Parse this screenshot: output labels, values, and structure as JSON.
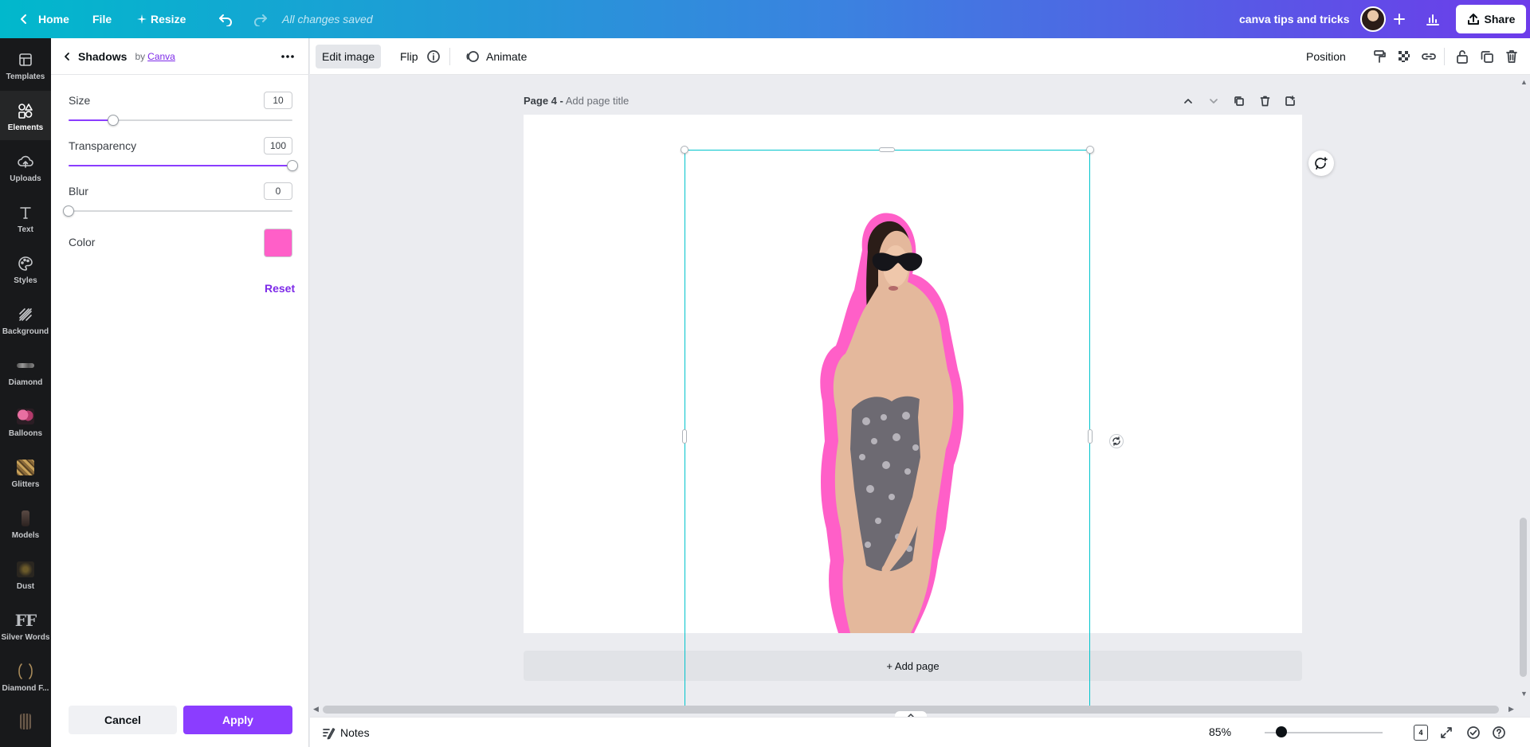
{
  "topbar": {
    "home_label": "Home",
    "file_label": "File",
    "resize_label": "Resize",
    "saved_status": "All changes saved",
    "project_title": "canva tips and tricks",
    "share_label": "Share"
  },
  "rail": {
    "items": [
      {
        "label": "Templates"
      },
      {
        "label": "Elements"
      },
      {
        "label": "Uploads"
      },
      {
        "label": "Text"
      },
      {
        "label": "Styles"
      },
      {
        "label": "Background"
      },
      {
        "label": "Diamond"
      },
      {
        "label": "Balloons"
      },
      {
        "label": "Glitters"
      },
      {
        "label": "Models"
      },
      {
        "label": "Dust"
      },
      {
        "label": "Silver Words"
      },
      {
        "label": "Diamond F..."
      }
    ],
    "silver_glyph": "FF"
  },
  "panel": {
    "title": "Shadows",
    "by_label": "by",
    "by_link": "Canva",
    "size_label": "Size",
    "size_value": "10",
    "size_level": 0.2,
    "transparency_label": "Transparency",
    "transparency_value": "100",
    "transparency_level": 1.0,
    "blur_label": "Blur",
    "blur_value": "0",
    "blur_level": 0.0,
    "color_label": "Color",
    "color_value": "#ff5fc8",
    "reset_label": "Reset",
    "cancel_label": "Cancel",
    "apply_label": "Apply"
  },
  "context_bar": {
    "edit_image_label": "Edit image",
    "flip_label": "Flip",
    "animate_label": "Animate",
    "position_label": "Position"
  },
  "canvas": {
    "page_label": "Page 4 -",
    "page_title_placeholder": "Add page title",
    "add_page_label": "+ Add page"
  },
  "statusbar": {
    "notes_label": "Notes",
    "zoom_label": "85%",
    "page_count": "4"
  },
  "colors": {
    "accent": "#8b3dff",
    "selection": "#00c4cc",
    "shadow": "#ff5fc8"
  }
}
